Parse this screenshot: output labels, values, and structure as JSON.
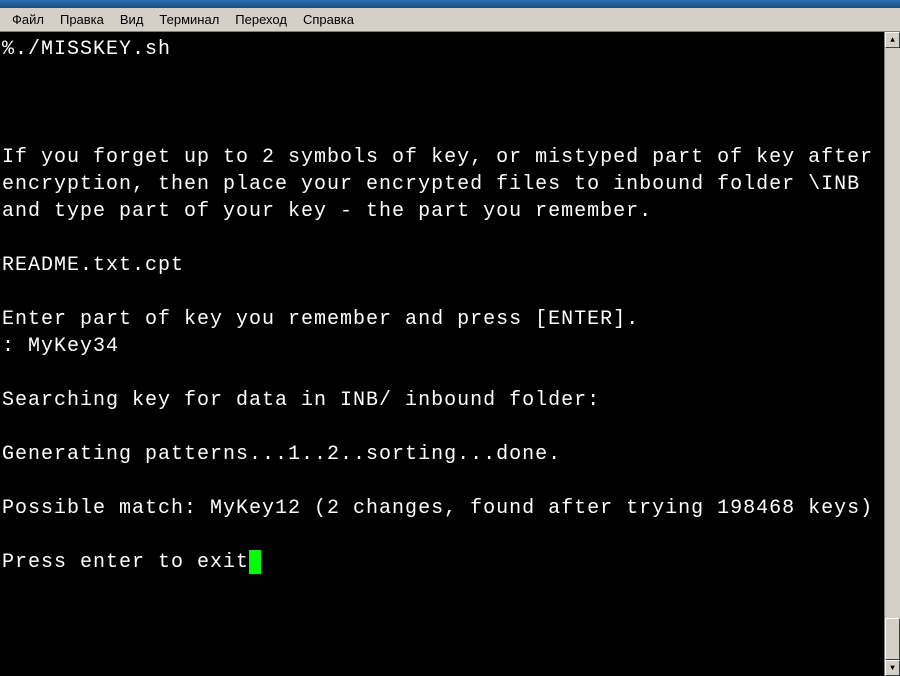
{
  "menubar": {
    "items": [
      {
        "label": "Файл"
      },
      {
        "label": "Правка"
      },
      {
        "label": "Вид"
      },
      {
        "label": "Терминал"
      },
      {
        "label": "Переход"
      },
      {
        "label": "Справка"
      }
    ]
  },
  "terminal": {
    "lines": [
      "%./MISSKEY.sh",
      "",
      "",
      "",
      "If you forget up to 2 symbols of key, or mistyped part of key after",
      "encryption, then place your encrypted files to inbound folder \\INB",
      "and type part of your key - the part you remember.",
      "",
      "README.txt.cpt",
      "",
      "Enter part of key you remember and press [ENTER].",
      ": MyKey34",
      "",
      "Searching key for data in INB/ inbound folder:",
      "",
      "Generating patterns...1..2..sorting...done.",
      "",
      "Possible match: MyKey12 (2 changes, found after trying 198468 keys)",
      "",
      "Press enter to exit"
    ],
    "cursor_visible": true
  },
  "scrollbar": {
    "up_glyph": "▲",
    "down_glyph": "▼"
  }
}
